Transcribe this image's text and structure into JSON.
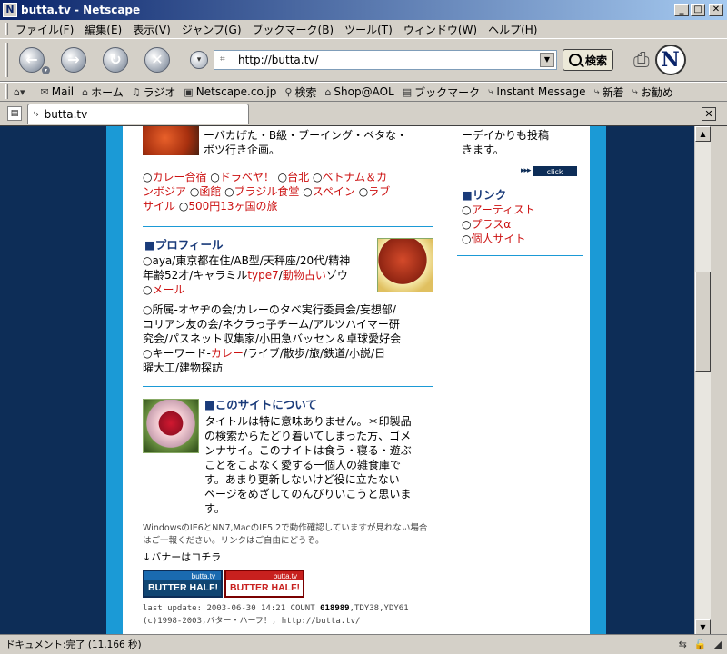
{
  "window": {
    "title": "butta.tv - Netscape",
    "app_icon": "N"
  },
  "menu": [
    "ファイル(F)",
    "編集(E)",
    "表示(V)",
    "ジャンプ(G)",
    "ブックマーク(B)",
    "ツール(T)",
    "ウィンドウ(W)",
    "ヘルプ(H)"
  ],
  "nav": {
    "back_icon": "←",
    "forward_icon": "→",
    "reload_icon": "↻",
    "stop_icon": "✕",
    "url": "http://butta.tv/",
    "search_label": "検索",
    "logo": "N"
  },
  "personal_bar": {
    "items": [
      "Mail",
      "ホーム",
      "ラジオ",
      "Netscape.co.jp",
      "検索",
      "Shop@AOL",
      "ブックマーク",
      "Instant Message",
      "新着",
      "お勧め"
    ]
  },
  "tab": {
    "label": "butta.tv"
  },
  "page": {
    "top_text_line1": "ーバカげた・B級・ブーイング・ベタな・",
    "top_text_line2": "ボツ行き企画。",
    "right_top_line1": "ーデイかりも投稿",
    "right_top_line2": "きます。",
    "click_label": "click",
    "click_arrows": "▸▸▸",
    "links_row1": [
      "カレー合宿",
      "ドラベヤ！",
      "台北",
      "ベトナム＆カ"
    ],
    "links_row2a": "ンボジア",
    "links_row2": [
      "函館",
      "ブラジル食堂",
      "スペイン",
      "ラブ"
    ],
    "links_row3a": "サイル",
    "links_row3": [
      "500円13ヶ国の旅"
    ],
    "circle": "○",
    "link_section": {
      "title": "■リンク",
      "items": [
        "アーティスト",
        "プラスα",
        "個人サイト"
      ]
    },
    "profile": {
      "title": "■プロフィール",
      "line1": "○aya/東京都在住/AB型/天秤座/20代/精神",
      "line2_a": "年齢52才/キャラミル",
      "line2_type": "type7",
      "line2_b": "/",
      "line2_link": "動物占い",
      "line2_c": "ゾウ",
      "mail_link": "メール",
      "line4": "○所属-オヤヂの会/カレーのタベ実行委員会/妄想部/",
      "line5": "コリアン友の会/ネクラっ子チーム/アルツハイマー研",
      "line6": "究会/パスネット収集家/小田急バッセン＆卓球愛好会",
      "line7_a": "○キーワード-",
      "line7_link": "カレー",
      "line7_b": "/ライブ/散歩/旅/鉄道/小説/日",
      "line8": "曜大工/建物探訪"
    },
    "about": {
      "title": "■このサイトについて",
      "lines": [
        "タイトルは特に意味ありません。＊印製品",
        "の検索からたどり着いてしまった方、ゴメ",
        "ンナサイ。このサイトは食う・寝る・遊ぶ",
        "ことをこよなく愛する一個人の雑食庫で",
        "す。あまり更新しないけど役に立たない",
        "ページをめざしてのんびりいこうと思いま",
        "す。"
      ]
    },
    "notice_line1": "WindowsのIE6とNN7,MacのIE5.2で動作確認していますが見れない場合",
    "notice_line2": "はご一報ください。リンクはご自由にどうぞ。",
    "banner_note": "↓バナーはコチラ",
    "banner_small": "butta.tv",
    "banner_big": "BUTTER HALF!",
    "footer_line1_a": "last update: 2003-06-30 14:21 COUNT ",
    "footer_count": "018989",
    "footer_line1_b": ",TDY38,YDY61",
    "footer_line2": "(c)1998-2003,バター・ハーフ！, http://butta.tv/"
  },
  "status": {
    "text": "ドキュメント:完了 (11.166 秒)"
  },
  "colors": {
    "page_bg": "#0d2d57",
    "frame_blue": "#1b9ad6",
    "link_red": "#cc1111",
    "heading_navy": "#1a3b7a"
  }
}
